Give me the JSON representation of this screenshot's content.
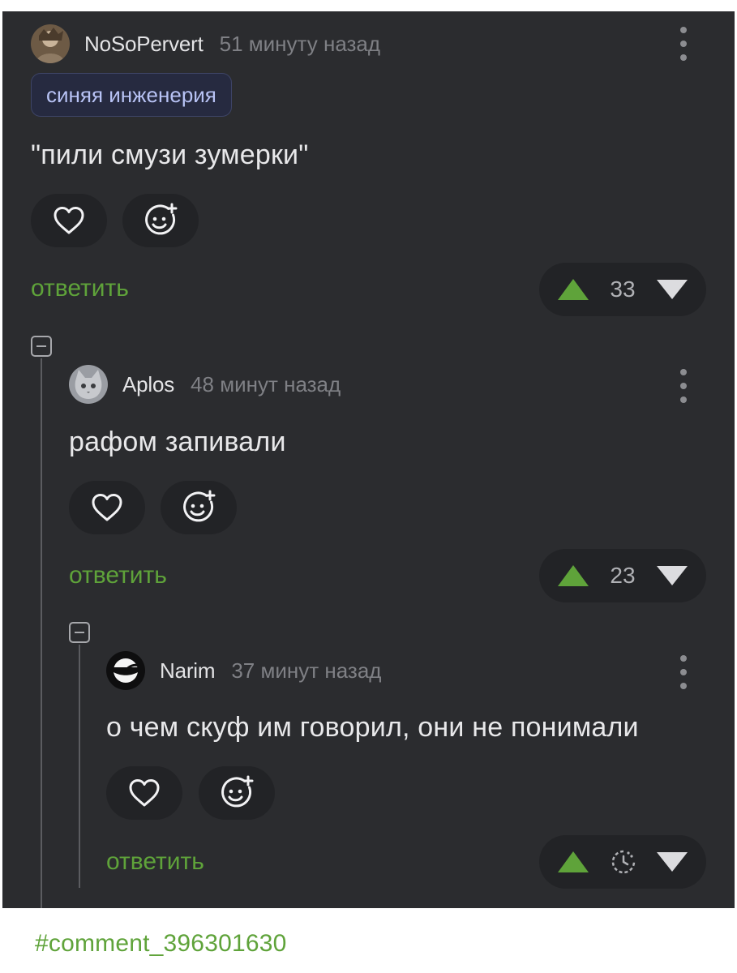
{
  "comments": [
    {
      "username": "NoSoPervert",
      "time": "51 минуту назад",
      "tag": "синяя инженерия",
      "text": "\"пили смузи зумерки\"",
      "reply_label": "ответить",
      "score": "33"
    },
    {
      "username": "Aplos",
      "time": "48 минут назад",
      "text": "рафом запивали",
      "reply_label": "ответить",
      "score": "23"
    },
    {
      "username": "Narim",
      "time": "37 минут назад",
      "text": "о чем скуф им говорил, они не понимали",
      "reply_label": "ответить",
      "score_icon": "clock-pending-icon"
    }
  ],
  "footer": {
    "hashtag": "#comment_396301630"
  },
  "colors": {
    "background": "#2b2c2f",
    "accent_green": "#5fa33a",
    "text": "#e8e8ea",
    "muted": "#7f8085",
    "tag_text": "#b8c3f5",
    "tag_bg": "#262a40"
  }
}
